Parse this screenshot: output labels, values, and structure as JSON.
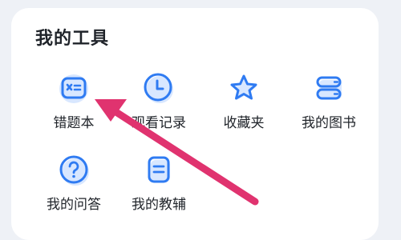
{
  "section": {
    "title": "我的工具"
  },
  "tools": [
    {
      "label": "错题本",
      "icon": "wrong-questions-icon"
    },
    {
      "label": "观看记录",
      "icon": "clock-icon"
    },
    {
      "label": "收藏夹",
      "icon": "star-icon"
    },
    {
      "label": "我的图书",
      "icon": "books-icon"
    },
    {
      "label": "我的问答",
      "icon": "question-icon"
    },
    {
      "label": "我的教辅",
      "icon": "document-icon"
    }
  ],
  "colors": {
    "icon_stroke": "#2f7bf2",
    "icon_fill": "#d8e7ff",
    "arrow": "#e0336f",
    "text": "#1f2329",
    "background": "#eef1f6",
    "card": "#ffffff"
  }
}
